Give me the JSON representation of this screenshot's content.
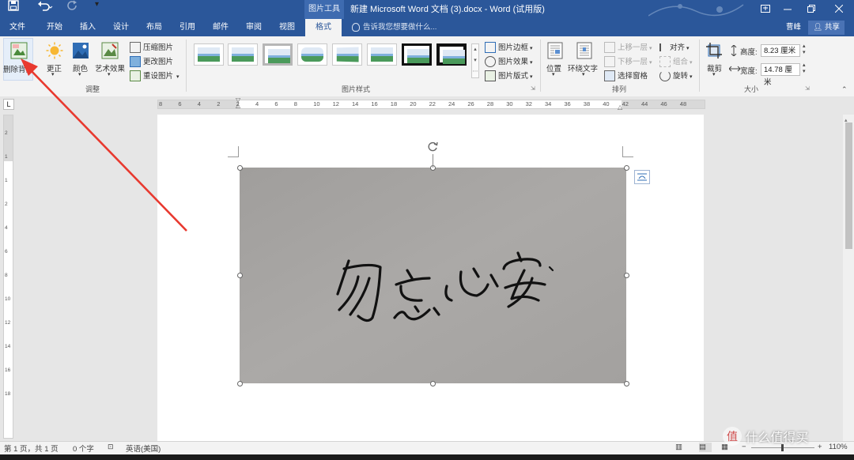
{
  "quick_access": {
    "save_icon": "save-icon",
    "undo_icon": "undo-icon",
    "redo_icon": "redo-icon"
  },
  "title_bar": {
    "context_tools": "图片工具",
    "doc_title": "新建 Microsoft Word 文档 (3).docx - Word (试用版)",
    "controls": [
      "restore-ribbon-icon",
      "minimize-icon",
      "maximize-icon",
      "close-icon"
    ]
  },
  "tabs": [
    "文件",
    "开始",
    "插入",
    "设计",
    "布局",
    "引用",
    "邮件",
    "审阅",
    "视图",
    "格式"
  ],
  "active_tab": "格式",
  "tell_me": "告诉我您想要做什么...",
  "user": {
    "name": "曹峰",
    "share": "共享"
  },
  "ribbon": {
    "remove_bg": "删除背景",
    "corrections": "更正",
    "color": "颜色",
    "artistic": "艺术效果",
    "compress": "压缩图片",
    "change": "更改图片",
    "reset": "重设图片",
    "group_adjust": "调整",
    "group_styles": "图片样式",
    "border": "图片边框",
    "effects": "图片效果",
    "layout": "图片版式",
    "position": "位置",
    "wrap": "环绕文字",
    "bring_forward": "上移一层",
    "send_backward": "下移一层",
    "selection_pane": "选择窗格",
    "align": "对齐",
    "group": "组合",
    "rotate": "旋转",
    "group_arrange": "排列",
    "crop": "裁剪",
    "height_label": "高度:",
    "height_value": "8.23 厘米",
    "width_label": "宽度:",
    "width_value": "14.78 厘米",
    "group_size": "大小"
  },
  "ruler": {
    "h_ticks": [
      "8",
      "6",
      "4",
      "2",
      "2",
      "4",
      "6",
      "8",
      "10",
      "12",
      "14",
      "16",
      "18",
      "20",
      "22",
      "24",
      "26",
      "28",
      "30",
      "32",
      "34",
      "36",
      "38",
      "40",
      "42",
      "44",
      "46",
      "48"
    ],
    "v_ticks": [
      "2",
      "1",
      "1",
      "2",
      "4",
      "6",
      "8",
      "10",
      "12",
      "14",
      "16",
      "18"
    ]
  },
  "document": {
    "image": "photo of handwritten signature 勿忘心安 on grey paper",
    "signature_text": "勿忘心安"
  },
  "status": {
    "page": "第 1 页，共 1 页",
    "words": "0 个字",
    "language": "英语(美国)",
    "zoom": "110%"
  },
  "watermark": "值 什么值得买",
  "colors": {
    "accent": "#2b579a",
    "annotation_arrow": "#e8392f"
  }
}
